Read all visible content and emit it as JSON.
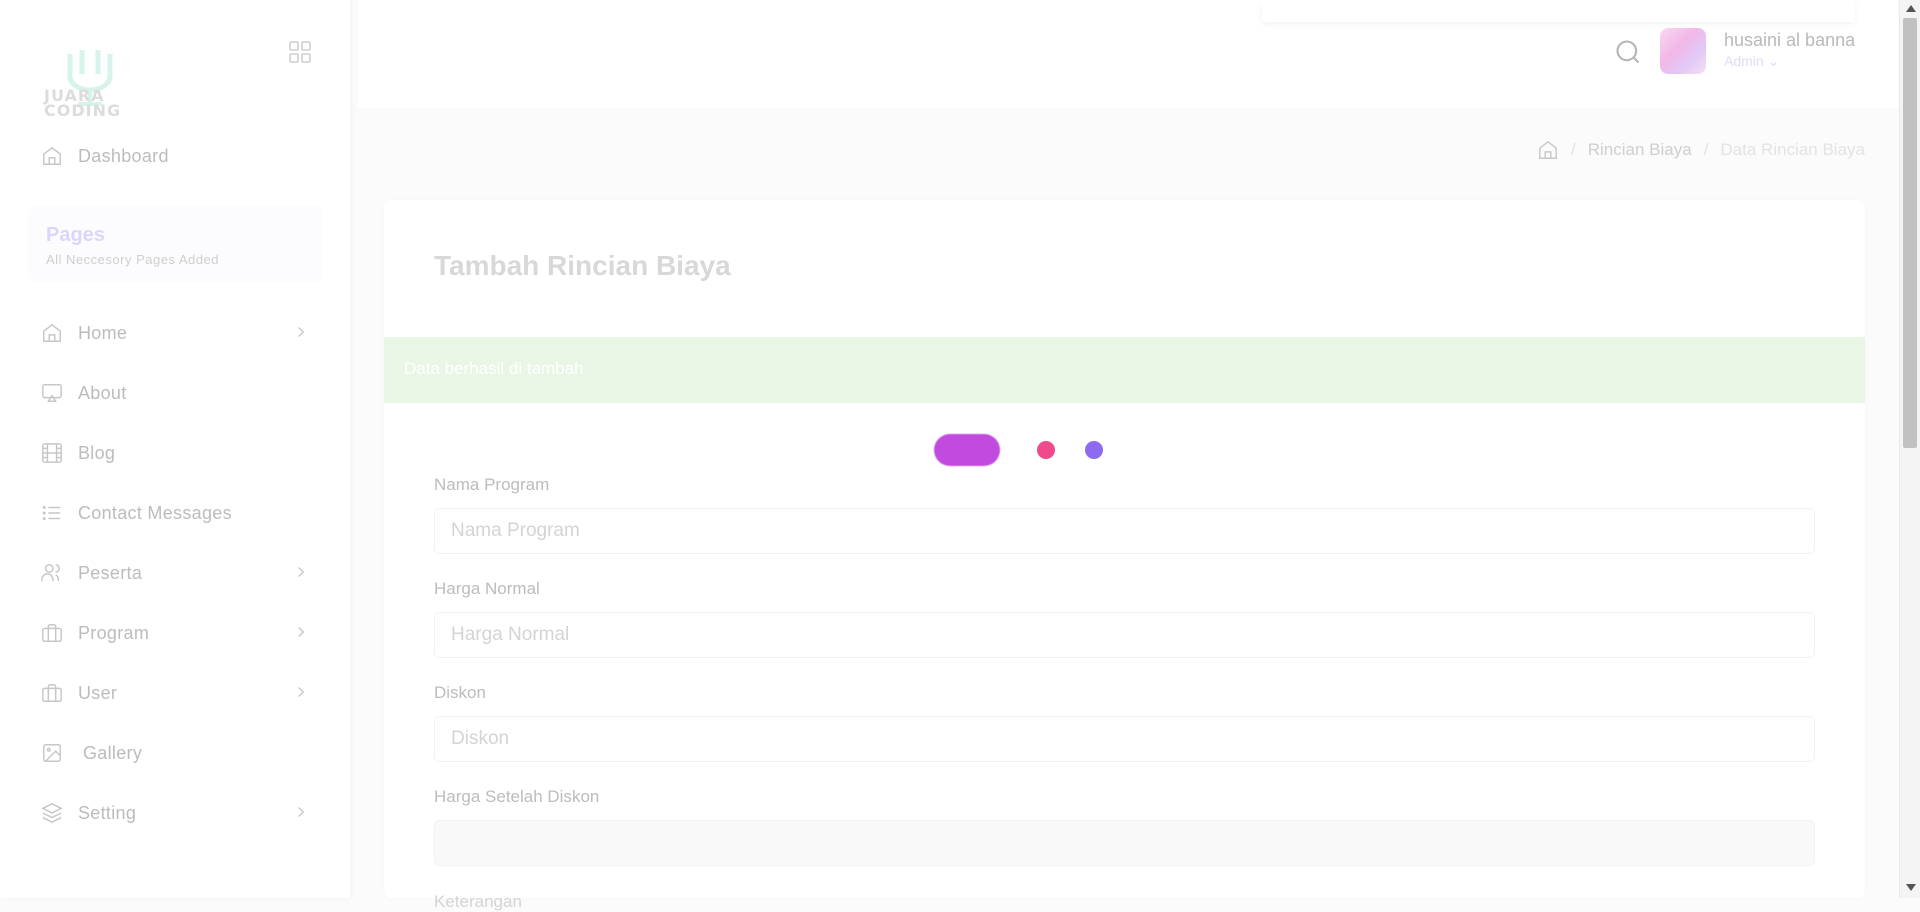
{
  "sidebar": {
    "logo_text": [
      "JUARA",
      "CODING"
    ],
    "top_item": {
      "label": "Dashboard",
      "icon": "home-icon"
    },
    "pages_title": "Pages",
    "pages_subtitle": "All Neccesory Pages Added",
    "items": [
      {
        "label": "Home",
        "icon": "home-icon",
        "has_children": true
      },
      {
        "label": "About",
        "icon": "monitor-icon",
        "has_children": false
      },
      {
        "label": "Blog",
        "icon": "film-icon",
        "has_children": false
      },
      {
        "label": "Contact Messages",
        "icon": "list-icon",
        "has_children": false
      },
      {
        "label": "Peserta",
        "icon": "users-icon",
        "has_children": true
      },
      {
        "label": "Program",
        "icon": "briefcase-icon",
        "has_children": true
      },
      {
        "label": "User",
        "icon": "briefcase-icon",
        "has_children": true
      },
      {
        "label": "Gallery",
        "icon": "image-icon",
        "has_children": false
      },
      {
        "label": "Setting",
        "icon": "layers-icon",
        "has_children": true
      }
    ]
  },
  "header": {
    "user_name": "husaini al banna",
    "user_role": "Admin ⌄"
  },
  "breadcrumb": {
    "link": "Rincian Biaya",
    "current": "Data Rincian Biaya"
  },
  "form": {
    "title": "Tambah Rincian Biaya",
    "alert": "Data berhasil di tambah",
    "fields": [
      {
        "label": "Nama Program",
        "placeholder": "Nama Program",
        "value": ""
      },
      {
        "label": "Harga Normal",
        "placeholder": "Harga Normal",
        "value": ""
      },
      {
        "label": "Diskon",
        "placeholder": "Diskon",
        "value": ""
      },
      {
        "label": "Harga Setelah Diskon",
        "placeholder": "",
        "value": ""
      }
    ],
    "next_label_partial": "Keterangan"
  },
  "colors": {
    "accent": "#7367f0",
    "success_bg": "#e9f6e6",
    "loader_1": "#c14bdf",
    "loader_2": "#ef4a8c",
    "loader_3": "#8d6af0"
  }
}
